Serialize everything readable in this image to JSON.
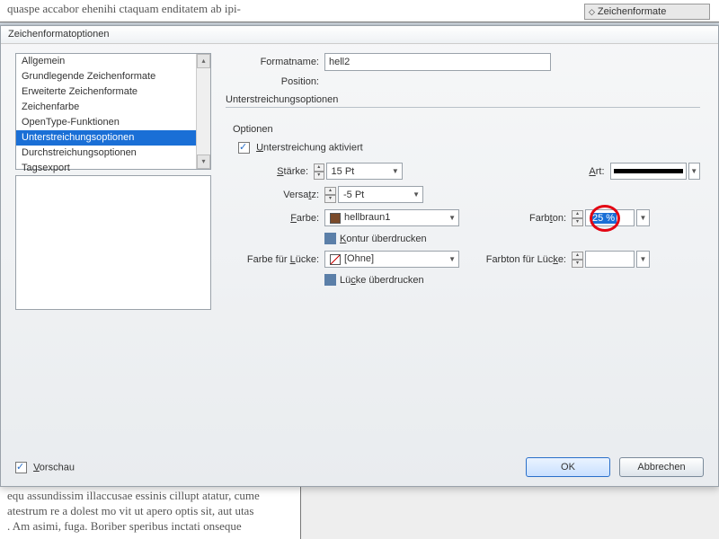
{
  "background": {
    "top_text": "quaspe accabor ehenihi ctaquam enditatem ab ipi-",
    "bottom_text_1": "equ assundissim illaccusae essinis cillupt atatur, cume",
    "bottom_text_2": "atestrum re a dolest mo vit ut apero optis sit, aut utas",
    "bottom_text_3": ". Am asimi, fuga. Boriber speribus inctati onseque",
    "panel_tab": "Zeichenformate"
  },
  "dialog": {
    "title": "Zeichenformatoptionen",
    "nav": {
      "items": [
        "Allgemein",
        "Grundlegende Zeichenformate",
        "Erweiterte Zeichenformate",
        "Zeichenfarbe",
        "OpenType-Funktionen",
        "Unterstreichungsoptionen",
        "Durchstreichungsoptionen",
        "Tagsexport"
      ],
      "selected_index": 5
    },
    "formatname_label": "Formatname:",
    "formatname_value": "hell2",
    "position_label": "Position:",
    "section_title": "Unterstreichungsoptionen",
    "options_label": "Optionen",
    "underline_checkbox": "Unterstreichung aktiviert",
    "staerke_label": "Stärke:",
    "staerke_value": "15 Pt",
    "versatz_label": "Versatz:",
    "versatz_value": "-5 Pt",
    "farbe_label": "Farbe:",
    "farbe_value": "hellbraun1",
    "kontur_label": "Kontur überdrucken",
    "farbe_luecke_label": "Farbe für Lücke:",
    "farbe_luecke_value": "[Ohne]",
    "luecke_ueber_label": "Lücke überdrucken",
    "art_label": "Art:",
    "farbton_label": "Farbton:",
    "farbton_value": "25 %",
    "farbton_luecke_label": "Farbton für Lücke:",
    "preview_label": "Vorschau",
    "ok_label": "OK",
    "cancel_label": "Abbrechen"
  }
}
